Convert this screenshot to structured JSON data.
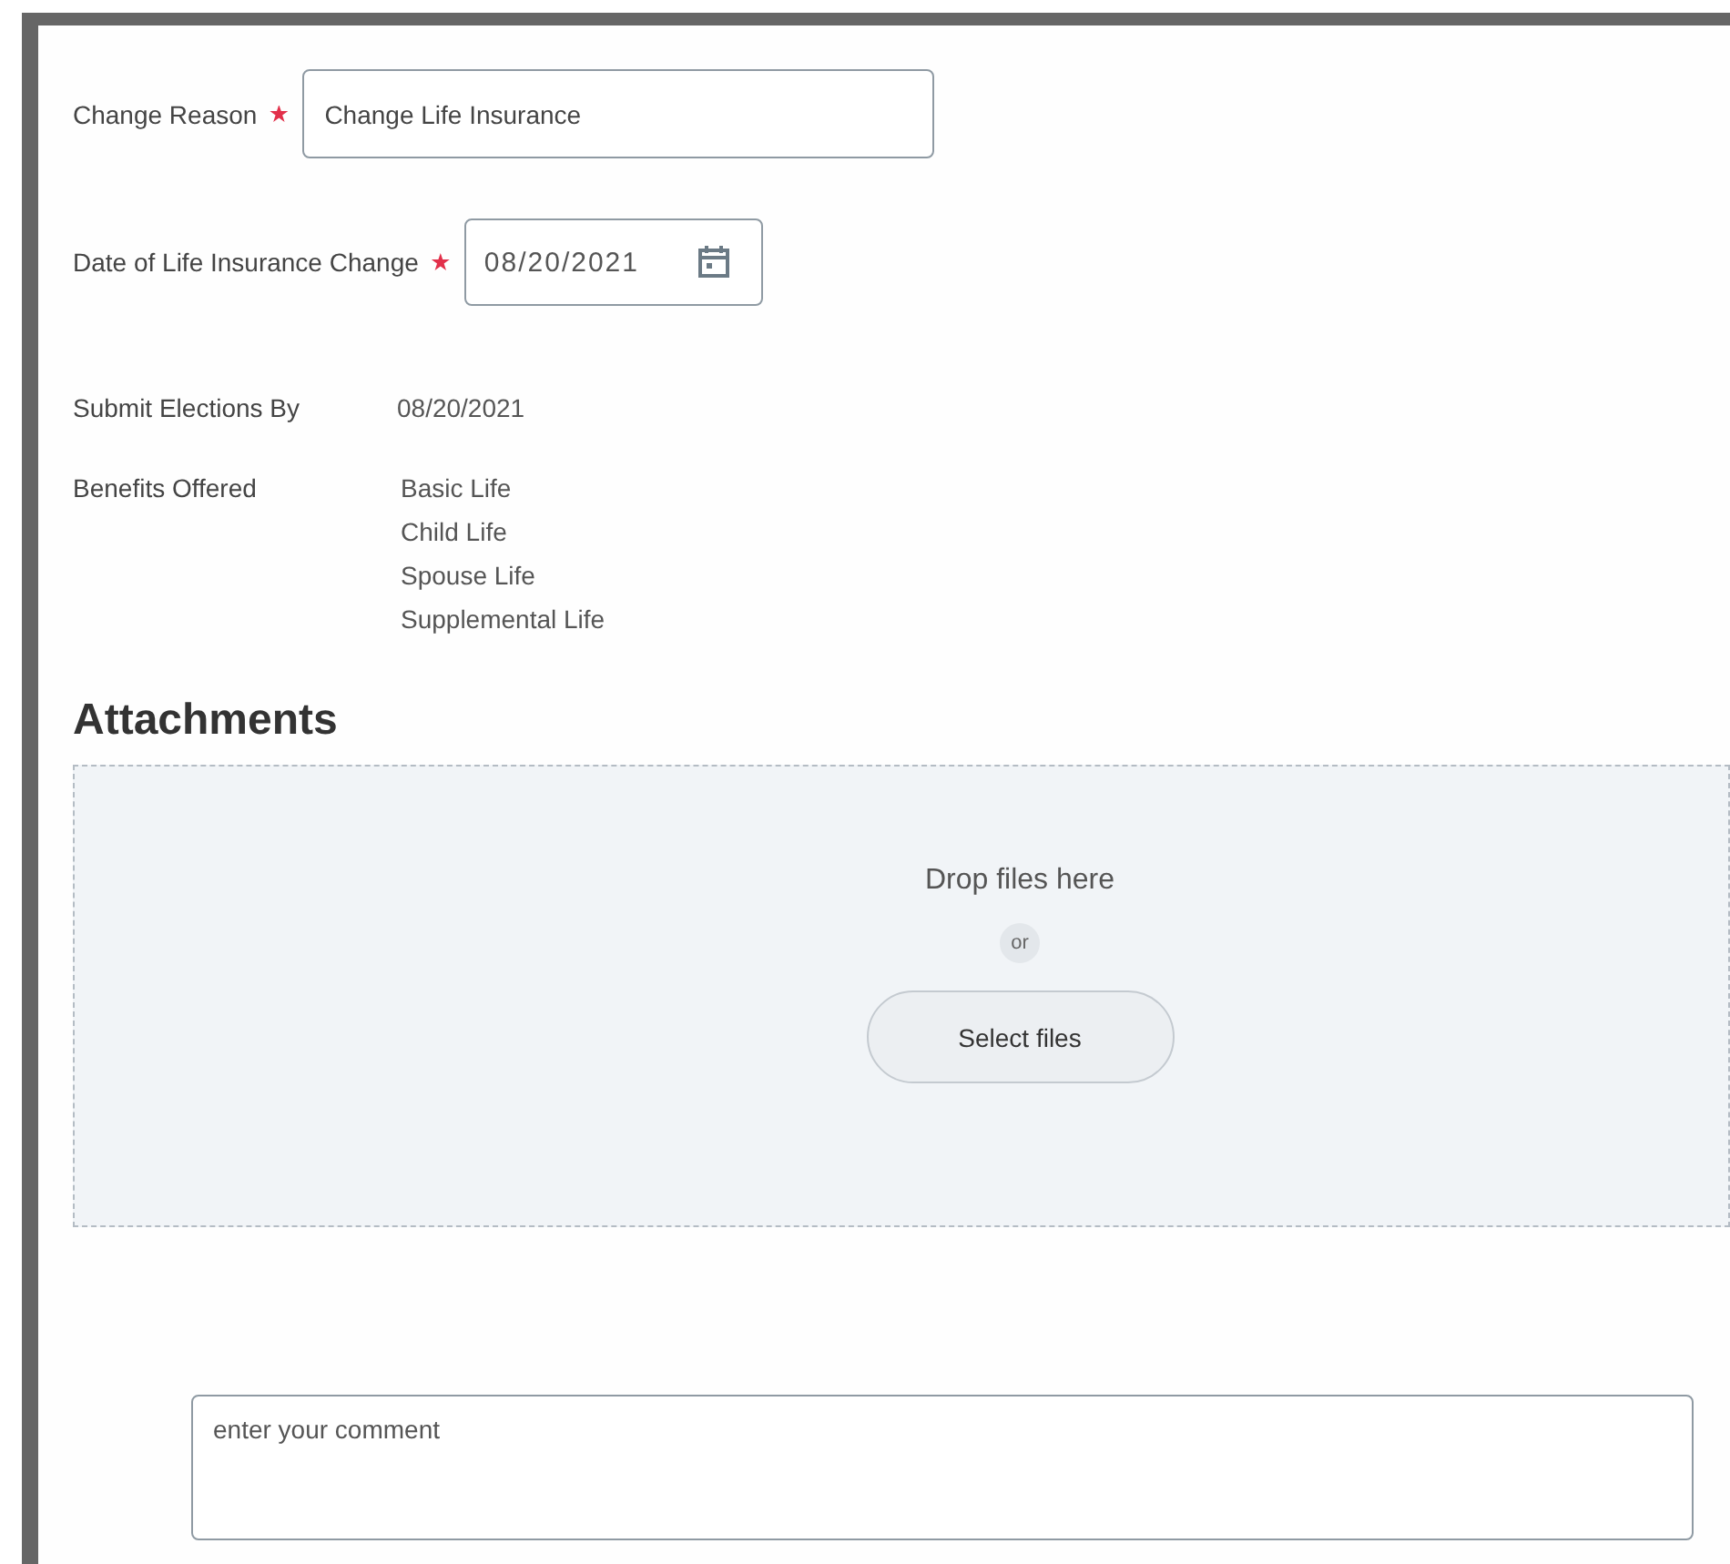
{
  "change_reason": {
    "label": "Change Reason",
    "required": true,
    "value": "Change Life Insurance"
  },
  "change_date": {
    "label": "Date of Life Insurance Change",
    "required": true,
    "value": "08/20/2021"
  },
  "details": [
    {
      "label": "Submit Elections By",
      "values": [
        "08/20/2021"
      ]
    },
    {
      "label": "Benefits Offered",
      "values": [
        "Basic Life",
        "Child Life",
        "Spouse Life",
        "Supplemental Life"
      ]
    }
  ],
  "attachments": {
    "title": "Attachments",
    "drop_text": "Drop files here",
    "or_text": "or",
    "button": "Select files"
  },
  "comment": {
    "placeholder": "enter your comment"
  }
}
